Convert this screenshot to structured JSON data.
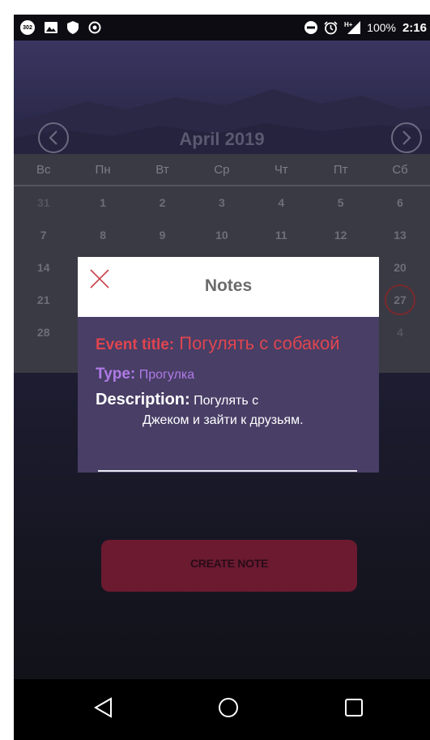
{
  "status_bar": {
    "badge": "302",
    "battery": "100%",
    "time": "2:16",
    "network": "H+"
  },
  "header": {
    "month": "April 2019"
  },
  "calendar": {
    "weekdays": [
      "Вс",
      "Пн",
      "Вт",
      "Ср",
      "Чт",
      "Пт",
      "Сб"
    ],
    "rows": [
      [
        "31",
        "1",
        "2",
        "3",
        "4",
        "5",
        "6"
      ],
      [
        "7",
        "8",
        "9",
        "10",
        "11",
        "12",
        "13"
      ],
      [
        "14",
        "",
        "",
        "",
        "",
        "",
        "20"
      ],
      [
        "21",
        "",
        "",
        "",
        "",
        "",
        "27"
      ],
      [
        "28",
        "",
        "",
        "",
        "",
        "",
        "4"
      ]
    ]
  },
  "modal": {
    "title": "Notes",
    "event_label": "Event   title:",
    "event_value": "Погулять с собакой",
    "type_label": "Type:",
    "type_value": "Прогулка",
    "description_label": "Description:",
    "description_value_1": "Погулять  с",
    "description_value_2": "Джеком  и зайти к друзьям."
  },
  "create_button": {
    "label": "CREATE NOTE"
  },
  "colors": {
    "accent_red": "#e0454f",
    "type_purple": "#b07ae6",
    "modal_bg": "#483e66",
    "button_bg": "#6b1a30"
  }
}
